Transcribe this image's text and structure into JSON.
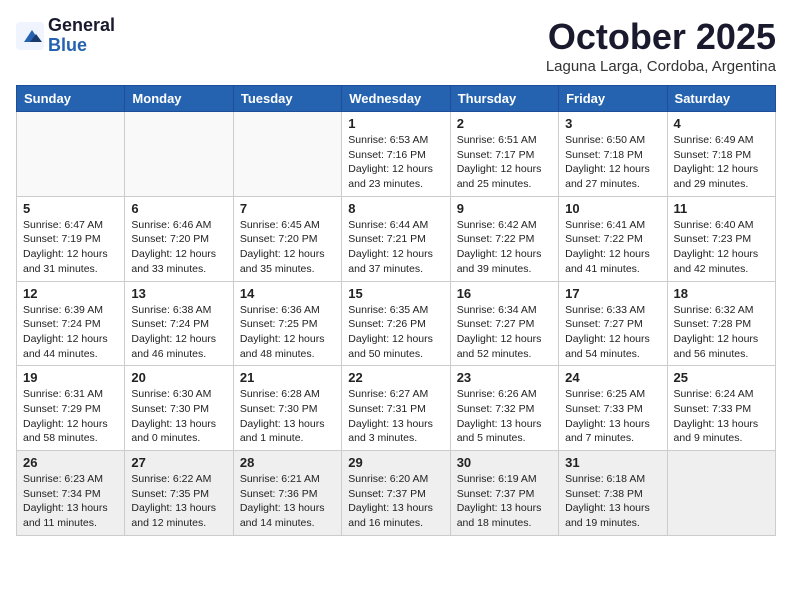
{
  "header": {
    "logo_general": "General",
    "logo_blue": "Blue",
    "month_title": "October 2025",
    "location": "Laguna Larga, Cordoba, Argentina"
  },
  "weekdays": [
    "Sunday",
    "Monday",
    "Tuesday",
    "Wednesday",
    "Thursday",
    "Friday",
    "Saturday"
  ],
  "weeks": [
    [
      {
        "day": "",
        "info": ""
      },
      {
        "day": "",
        "info": ""
      },
      {
        "day": "",
        "info": ""
      },
      {
        "day": "1",
        "info": "Sunrise: 6:53 AM\nSunset: 7:16 PM\nDaylight: 12 hours\nand 23 minutes."
      },
      {
        "day": "2",
        "info": "Sunrise: 6:51 AM\nSunset: 7:17 PM\nDaylight: 12 hours\nand 25 minutes."
      },
      {
        "day": "3",
        "info": "Sunrise: 6:50 AM\nSunset: 7:18 PM\nDaylight: 12 hours\nand 27 minutes."
      },
      {
        "day": "4",
        "info": "Sunrise: 6:49 AM\nSunset: 7:18 PM\nDaylight: 12 hours\nand 29 minutes."
      }
    ],
    [
      {
        "day": "5",
        "info": "Sunrise: 6:47 AM\nSunset: 7:19 PM\nDaylight: 12 hours\nand 31 minutes."
      },
      {
        "day": "6",
        "info": "Sunrise: 6:46 AM\nSunset: 7:20 PM\nDaylight: 12 hours\nand 33 minutes."
      },
      {
        "day": "7",
        "info": "Sunrise: 6:45 AM\nSunset: 7:20 PM\nDaylight: 12 hours\nand 35 minutes."
      },
      {
        "day": "8",
        "info": "Sunrise: 6:44 AM\nSunset: 7:21 PM\nDaylight: 12 hours\nand 37 minutes."
      },
      {
        "day": "9",
        "info": "Sunrise: 6:42 AM\nSunset: 7:22 PM\nDaylight: 12 hours\nand 39 minutes."
      },
      {
        "day": "10",
        "info": "Sunrise: 6:41 AM\nSunset: 7:22 PM\nDaylight: 12 hours\nand 41 minutes."
      },
      {
        "day": "11",
        "info": "Sunrise: 6:40 AM\nSunset: 7:23 PM\nDaylight: 12 hours\nand 42 minutes."
      }
    ],
    [
      {
        "day": "12",
        "info": "Sunrise: 6:39 AM\nSunset: 7:24 PM\nDaylight: 12 hours\nand 44 minutes."
      },
      {
        "day": "13",
        "info": "Sunrise: 6:38 AM\nSunset: 7:24 PM\nDaylight: 12 hours\nand 46 minutes."
      },
      {
        "day": "14",
        "info": "Sunrise: 6:36 AM\nSunset: 7:25 PM\nDaylight: 12 hours\nand 48 minutes."
      },
      {
        "day": "15",
        "info": "Sunrise: 6:35 AM\nSunset: 7:26 PM\nDaylight: 12 hours\nand 50 minutes."
      },
      {
        "day": "16",
        "info": "Sunrise: 6:34 AM\nSunset: 7:27 PM\nDaylight: 12 hours\nand 52 minutes."
      },
      {
        "day": "17",
        "info": "Sunrise: 6:33 AM\nSunset: 7:27 PM\nDaylight: 12 hours\nand 54 minutes."
      },
      {
        "day": "18",
        "info": "Sunrise: 6:32 AM\nSunset: 7:28 PM\nDaylight: 12 hours\nand 56 minutes."
      }
    ],
    [
      {
        "day": "19",
        "info": "Sunrise: 6:31 AM\nSunset: 7:29 PM\nDaylight: 12 hours\nand 58 minutes."
      },
      {
        "day": "20",
        "info": "Sunrise: 6:30 AM\nSunset: 7:30 PM\nDaylight: 13 hours\nand 0 minutes."
      },
      {
        "day": "21",
        "info": "Sunrise: 6:28 AM\nSunset: 7:30 PM\nDaylight: 13 hours\nand 1 minute."
      },
      {
        "day": "22",
        "info": "Sunrise: 6:27 AM\nSunset: 7:31 PM\nDaylight: 13 hours\nand 3 minutes."
      },
      {
        "day": "23",
        "info": "Sunrise: 6:26 AM\nSunset: 7:32 PM\nDaylight: 13 hours\nand 5 minutes."
      },
      {
        "day": "24",
        "info": "Sunrise: 6:25 AM\nSunset: 7:33 PM\nDaylight: 13 hours\nand 7 minutes."
      },
      {
        "day": "25",
        "info": "Sunrise: 6:24 AM\nSunset: 7:33 PM\nDaylight: 13 hours\nand 9 minutes."
      }
    ],
    [
      {
        "day": "26",
        "info": "Sunrise: 6:23 AM\nSunset: 7:34 PM\nDaylight: 13 hours\nand 11 minutes."
      },
      {
        "day": "27",
        "info": "Sunrise: 6:22 AM\nSunset: 7:35 PM\nDaylight: 13 hours\nand 12 minutes."
      },
      {
        "day": "28",
        "info": "Sunrise: 6:21 AM\nSunset: 7:36 PM\nDaylight: 13 hours\nand 14 minutes."
      },
      {
        "day": "29",
        "info": "Sunrise: 6:20 AM\nSunset: 7:37 PM\nDaylight: 13 hours\nand 16 minutes."
      },
      {
        "day": "30",
        "info": "Sunrise: 6:19 AM\nSunset: 7:37 PM\nDaylight: 13 hours\nand 18 minutes."
      },
      {
        "day": "31",
        "info": "Sunrise: 6:18 AM\nSunset: 7:38 PM\nDaylight: 13 hours\nand 19 minutes."
      },
      {
        "day": "",
        "info": ""
      }
    ]
  ]
}
